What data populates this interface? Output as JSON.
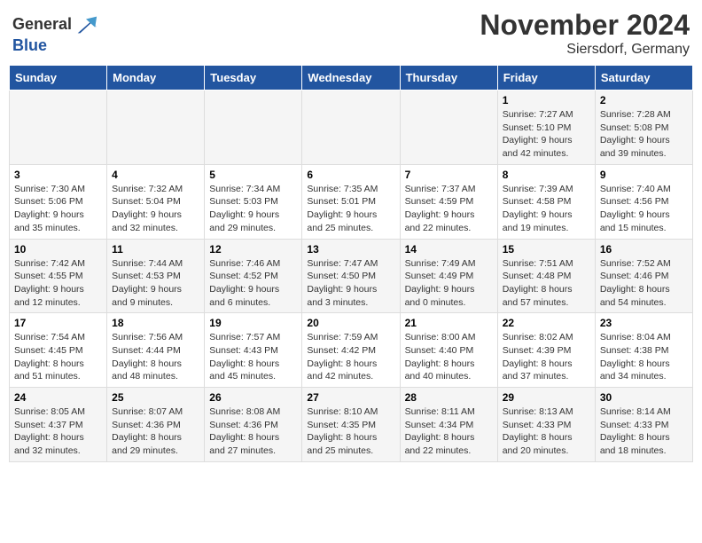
{
  "header": {
    "logo_general": "General",
    "logo_blue": "Blue",
    "month_title": "November 2024",
    "location": "Siersdorf, Germany"
  },
  "weekdays": [
    "Sunday",
    "Monday",
    "Tuesday",
    "Wednesday",
    "Thursday",
    "Friday",
    "Saturday"
  ],
  "weeks": [
    [
      {
        "day": "",
        "info": ""
      },
      {
        "day": "",
        "info": ""
      },
      {
        "day": "",
        "info": ""
      },
      {
        "day": "",
        "info": ""
      },
      {
        "day": "",
        "info": ""
      },
      {
        "day": "1",
        "info": "Sunrise: 7:27 AM\nSunset: 5:10 PM\nDaylight: 9 hours and 42 minutes."
      },
      {
        "day": "2",
        "info": "Sunrise: 7:28 AM\nSunset: 5:08 PM\nDaylight: 9 hours and 39 minutes."
      }
    ],
    [
      {
        "day": "3",
        "info": "Sunrise: 7:30 AM\nSunset: 5:06 PM\nDaylight: 9 hours and 35 minutes."
      },
      {
        "day": "4",
        "info": "Sunrise: 7:32 AM\nSunset: 5:04 PM\nDaylight: 9 hours and 32 minutes."
      },
      {
        "day": "5",
        "info": "Sunrise: 7:34 AM\nSunset: 5:03 PM\nDaylight: 9 hours and 29 minutes."
      },
      {
        "day": "6",
        "info": "Sunrise: 7:35 AM\nSunset: 5:01 PM\nDaylight: 9 hours and 25 minutes."
      },
      {
        "day": "7",
        "info": "Sunrise: 7:37 AM\nSunset: 4:59 PM\nDaylight: 9 hours and 22 minutes."
      },
      {
        "day": "8",
        "info": "Sunrise: 7:39 AM\nSunset: 4:58 PM\nDaylight: 9 hours and 19 minutes."
      },
      {
        "day": "9",
        "info": "Sunrise: 7:40 AM\nSunset: 4:56 PM\nDaylight: 9 hours and 15 minutes."
      }
    ],
    [
      {
        "day": "10",
        "info": "Sunrise: 7:42 AM\nSunset: 4:55 PM\nDaylight: 9 hours and 12 minutes."
      },
      {
        "day": "11",
        "info": "Sunrise: 7:44 AM\nSunset: 4:53 PM\nDaylight: 9 hours and 9 minutes."
      },
      {
        "day": "12",
        "info": "Sunrise: 7:46 AM\nSunset: 4:52 PM\nDaylight: 9 hours and 6 minutes."
      },
      {
        "day": "13",
        "info": "Sunrise: 7:47 AM\nSunset: 4:50 PM\nDaylight: 9 hours and 3 minutes."
      },
      {
        "day": "14",
        "info": "Sunrise: 7:49 AM\nSunset: 4:49 PM\nDaylight: 9 hours and 0 minutes."
      },
      {
        "day": "15",
        "info": "Sunrise: 7:51 AM\nSunset: 4:48 PM\nDaylight: 8 hours and 57 minutes."
      },
      {
        "day": "16",
        "info": "Sunrise: 7:52 AM\nSunset: 4:46 PM\nDaylight: 8 hours and 54 minutes."
      }
    ],
    [
      {
        "day": "17",
        "info": "Sunrise: 7:54 AM\nSunset: 4:45 PM\nDaylight: 8 hours and 51 minutes."
      },
      {
        "day": "18",
        "info": "Sunrise: 7:56 AM\nSunset: 4:44 PM\nDaylight: 8 hours and 48 minutes."
      },
      {
        "day": "19",
        "info": "Sunrise: 7:57 AM\nSunset: 4:43 PM\nDaylight: 8 hours and 45 minutes."
      },
      {
        "day": "20",
        "info": "Sunrise: 7:59 AM\nSunset: 4:42 PM\nDaylight: 8 hours and 42 minutes."
      },
      {
        "day": "21",
        "info": "Sunrise: 8:00 AM\nSunset: 4:40 PM\nDaylight: 8 hours and 40 minutes."
      },
      {
        "day": "22",
        "info": "Sunrise: 8:02 AM\nSunset: 4:39 PM\nDaylight: 8 hours and 37 minutes."
      },
      {
        "day": "23",
        "info": "Sunrise: 8:04 AM\nSunset: 4:38 PM\nDaylight: 8 hours and 34 minutes."
      }
    ],
    [
      {
        "day": "24",
        "info": "Sunrise: 8:05 AM\nSunset: 4:37 PM\nDaylight: 8 hours and 32 minutes."
      },
      {
        "day": "25",
        "info": "Sunrise: 8:07 AM\nSunset: 4:36 PM\nDaylight: 8 hours and 29 minutes."
      },
      {
        "day": "26",
        "info": "Sunrise: 8:08 AM\nSunset: 4:36 PM\nDaylight: 8 hours and 27 minutes."
      },
      {
        "day": "27",
        "info": "Sunrise: 8:10 AM\nSunset: 4:35 PM\nDaylight: 8 hours and 25 minutes."
      },
      {
        "day": "28",
        "info": "Sunrise: 8:11 AM\nSunset: 4:34 PM\nDaylight: 8 hours and 22 minutes."
      },
      {
        "day": "29",
        "info": "Sunrise: 8:13 AM\nSunset: 4:33 PM\nDaylight: 8 hours and 20 minutes."
      },
      {
        "day": "30",
        "info": "Sunrise: 8:14 AM\nSunset: 4:33 PM\nDaylight: 8 hours and 18 minutes."
      }
    ]
  ]
}
